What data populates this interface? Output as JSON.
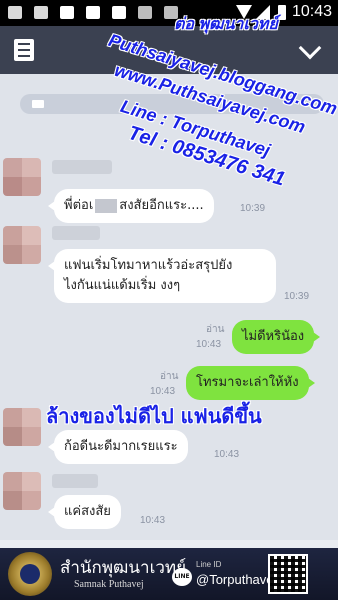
{
  "status_bar": {
    "time": "10:43",
    "icons": [
      "message-icon",
      "image-icon",
      "facebook-icon",
      "facebook-icon",
      "facebook-icon",
      "check-icon",
      "check-icon",
      "wifi-icon",
      "signal-icon",
      "battery-icon"
    ]
  },
  "header": {
    "left_icon": "document-icon",
    "right_icon": "chevron-down-icon"
  },
  "watermark": {
    "line1": "ต่อ พุฒนาเวทย์",
    "line2": "Puthsaiyavej.bloggang.com",
    "line3": "www.Puthsaiyavej.com",
    "line4": "Line : Torputhavej",
    "line5": "Tel : 0853476 341"
  },
  "chat": {
    "notice_text": "",
    "messages": [
      {
        "side": "left",
        "text_before_mask": "พี่ต่อเ",
        "text_after_mask": "สงสัยอีกแระ....",
        "time": "10:39"
      },
      {
        "side": "left",
        "text_line1": "แฟนเริ่มโทมาหาแร้วอ่ะสรุปยัง",
        "text_line2": "ไงกันแน่แด้มเริ่ม งงๆ",
        "time": "10:39"
      },
      {
        "side": "right",
        "text": "ไม่ดีหรินัอง",
        "read": "อ่าน",
        "time": "10:43"
      },
      {
        "side": "right",
        "text": "โทรมาจะเล่าให้หัง",
        "read": "อ่าน",
        "time": "10:43"
      },
      {
        "side": "left",
        "text": "ก้อดีนะดีมากเรยแระ",
        "time": "10:43"
      },
      {
        "side": "left",
        "text": "แค่สงสัย",
        "time": "10:43"
      }
    ],
    "caption": "ล้างของไม่ดีไป แฟนดีขึ้น"
  },
  "banner": {
    "thai_name": "สำนักพุฒนาเวทย์",
    "english_name": "Samnak Puthavej",
    "line_icon_text": "LINE",
    "line_id_label": "Line ID",
    "line_handle": "@Torputhavej",
    "qr_icon": "qr-code-icon",
    "emblem_icon": "emblem-icon"
  },
  "colors": {
    "header": "#3b4151",
    "chat_bg": "#dfe3ea",
    "sent_bubble": "#7fe33f",
    "watermark": "#1a22e6"
  }
}
